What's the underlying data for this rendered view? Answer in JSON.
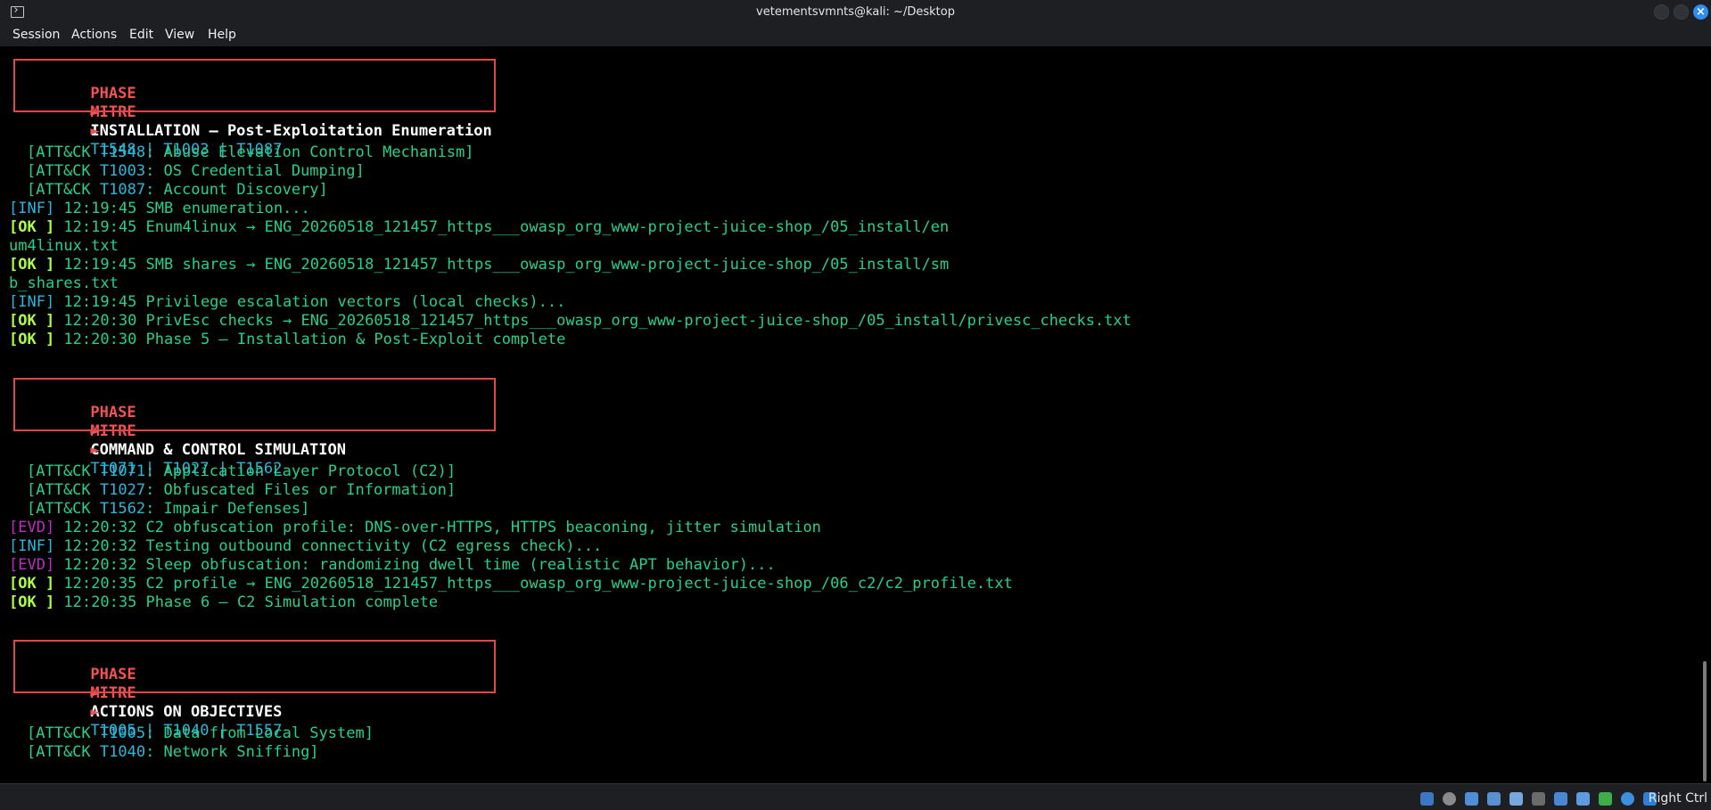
{
  "window": {
    "title": "vetementsvmnts@kali: ~/Desktop"
  },
  "menu": [
    "Session",
    "Actions",
    "Edit",
    "View",
    "Help"
  ],
  "phases": [
    {
      "phase_label": "PHASE",
      "arrow": "►",
      "name": "INSTALLATION — Post-Exploitation Enumeration",
      "mitre_label": "MITRE",
      "mitre_ids": "T1548 | T1003 | T1087"
    },
    {
      "phase_label": "PHASE",
      "arrow": "►",
      "name": "COMMAND & CONTROL SIMULATION",
      "mitre_label": "MITRE",
      "mitre_ids": "T1071 | T1027 | T1562"
    },
    {
      "phase_label": "PHASE",
      "arrow": "►",
      "name": "ACTIONS ON OBJECTIVES",
      "mitre_label": "MITRE",
      "mitre_ids": "T1005 | T1040 | T1557"
    }
  ],
  "lines": {
    "l1": {
      "prefix": "[ATT&CK ",
      "id": "T1548",
      "text": ": Abuse Elevation Control Mechanism]"
    },
    "l2": {
      "prefix": "[ATT&CK ",
      "id": "T1003",
      "text": ": OS Credential Dumping]"
    },
    "l3": {
      "prefix": "[ATT&CK ",
      "id": "T1087",
      "text": ": Account Discovery]"
    },
    "l4": {
      "tag": "[INF]",
      "text": " 12:19:45 SMB enumeration..."
    },
    "l5": {
      "tag": "[OK ]",
      "text": " 12:19:45 Enum4linux → ENG_20260518_121457_https___owasp_org_www-project-juice-shop_/05_install/en"
    },
    "l6": {
      "text": "um4linux.txt"
    },
    "l7": {
      "tag": "[OK ]",
      "text": " 12:19:45 SMB shares → ENG_20260518_121457_https___owasp_org_www-project-juice-shop_/05_install/sm"
    },
    "l8": {
      "text": "b_shares.txt"
    },
    "l9": {
      "tag": "[INF]",
      "text": " 12:19:45 Privilege escalation vectors (local checks)..."
    },
    "l10": {
      "tag": "[OK ]",
      "text": " 12:20:30 PrivEsc checks → ENG_20260518_121457_https___owasp_org_www-project-juice-shop_/05_install/privesc_checks.txt"
    },
    "l11": {
      "tag": "[OK ]",
      "text": " 12:20:30 Phase 5 — Installation & Post-Exploit complete"
    },
    "l12": {
      "prefix": "[ATT&CK ",
      "id": "T1071",
      "text": ": Application Layer Protocol (C2)]"
    },
    "l13": {
      "prefix": "[ATT&CK ",
      "id": "T1027",
      "text": ": Obfuscated Files or Information]"
    },
    "l14": {
      "prefix": "[ATT&CK ",
      "id": "T1562",
      "text": ": Impair Defenses]"
    },
    "l15": {
      "tag": "[EVD]",
      "text": " 12:20:32 C2 obfuscation profile: DNS-over-HTTPS, HTTPS beaconing, jitter simulation"
    },
    "l16": {
      "tag": "[INF]",
      "text": " 12:20:32 Testing outbound connectivity (C2 egress check)..."
    },
    "l17": {
      "tag": "[EVD]",
      "text": " 12:20:32 Sleep obfuscation: randomizing dwell time (realistic APT behavior)..."
    },
    "l18": {
      "tag": "[OK ]",
      "text": " 12:20:35 C2 profile → ENG_20260518_121457_https___owasp_org_www-project-juice-shop_/06_c2/c2_profile.txt"
    },
    "l19": {
      "tag": "[OK ]",
      "text": " 12:20:35 Phase 6 — C2 Simulation complete"
    },
    "l20": {
      "prefix": "[ATT&CK ",
      "id": "T1005",
      "text": ": Data from Local System]"
    },
    "l21": {
      "prefix": "[ATT&CK ",
      "id": "T1040",
      "text": ": Network Sniffing]"
    }
  },
  "status": {
    "host_key": "Right Ctrl"
  },
  "colors": {
    "ok": "#aaff44",
    "inf": "#29b8db",
    "evd": "#c02cc2",
    "text": "#23d18b",
    "phase": "#f25252"
  }
}
